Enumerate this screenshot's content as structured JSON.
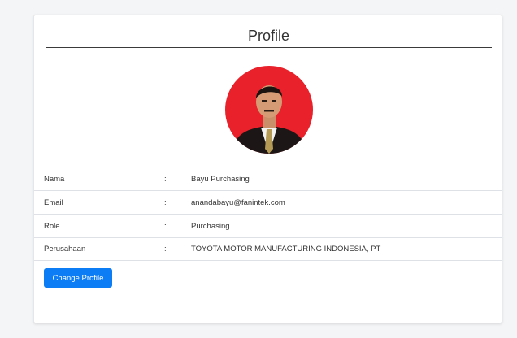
{
  "profile": {
    "title": "Profile",
    "avatar_icon": "user-photo",
    "fields": [
      {
        "label": "Nama",
        "separator": ":",
        "value": "Bayu Purchasing"
      },
      {
        "label": "Email",
        "separator": ":",
        "value": "anandabayu@fanintek.com"
      },
      {
        "label": "Role",
        "separator": ":",
        "value": "Purchasing"
      },
      {
        "label": "Perusahaan",
        "separator": ":",
        "value": "TOYOTA MOTOR MANUFACTURING INDONESIA, PT"
      }
    ],
    "change_button_label": "Change Profile"
  },
  "colors": {
    "accent": "#0d7df6",
    "avatar_background": "#e8212a"
  }
}
